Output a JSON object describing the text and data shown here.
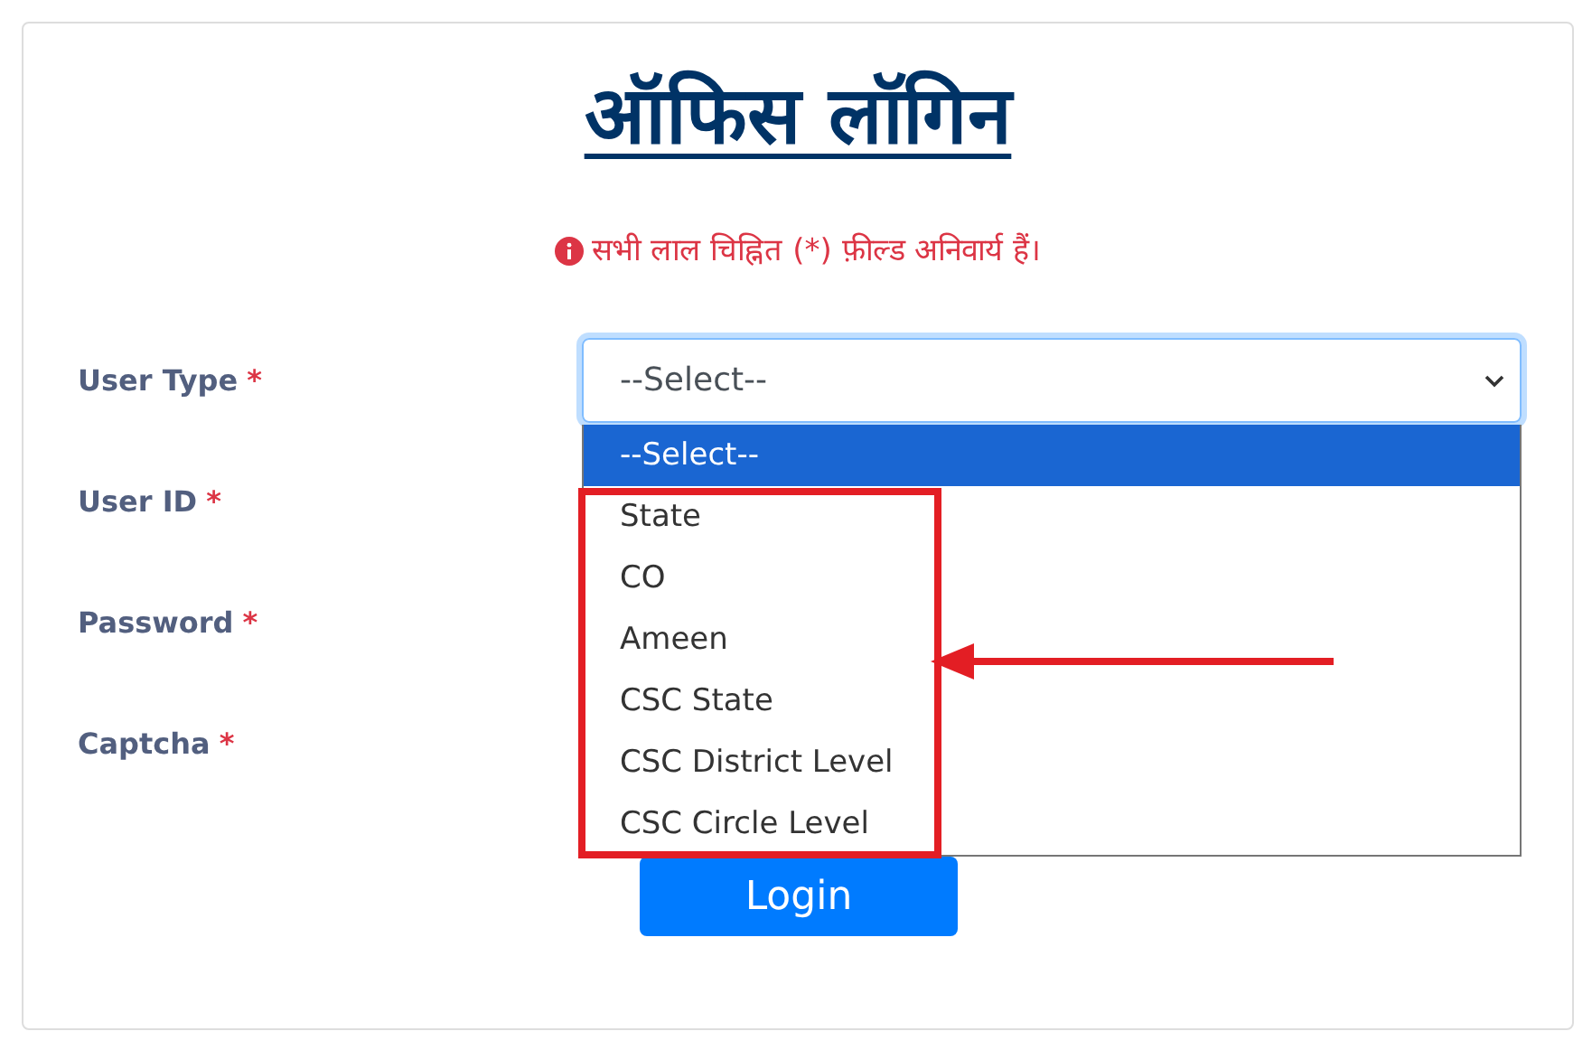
{
  "title": "ऑफिस लॉगिन",
  "notice": "सभी लाल चिह्नित (*) फ़ील्ड अनिवार्य हैं।",
  "required_mark": "*",
  "fields": [
    {
      "label": "User Type",
      "required": true,
      "kind": "select",
      "value": "--Select--"
    },
    {
      "label": "User ID",
      "required": true,
      "kind": "hidden"
    },
    {
      "label": "Password",
      "required": true,
      "kind": "hidden"
    },
    {
      "label": "Captcha",
      "required": true,
      "kind": "hidden"
    }
  ],
  "dropdown": {
    "expanded": true,
    "options": [
      {
        "label": "--Select--",
        "selected": true
      },
      {
        "label": "State",
        "selected": false
      },
      {
        "label": "CO",
        "selected": false
      },
      {
        "label": "Ameen",
        "selected": false
      },
      {
        "label": "CSC State",
        "selected": false
      },
      {
        "label": "CSC District Level",
        "selected": false
      },
      {
        "label": "CSC Circle Level",
        "selected": false
      }
    ]
  },
  "login_button": "Login"
}
